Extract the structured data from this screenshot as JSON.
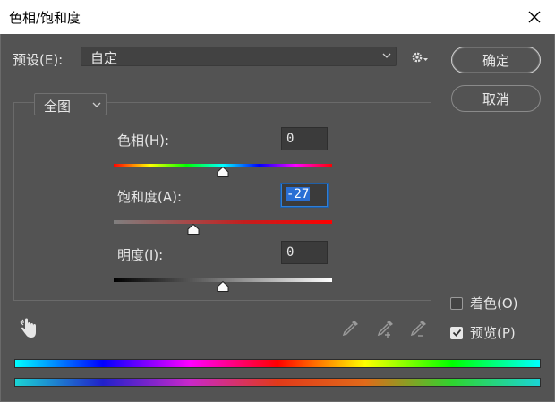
{
  "window": {
    "title": "色相/饱和度"
  },
  "preset": {
    "label": "预设(E):",
    "value": "自定"
  },
  "buttons": {
    "ok": "确定",
    "cancel": "取消"
  },
  "channel": {
    "value": "全图"
  },
  "sliders": [
    {
      "label": "色相(H):",
      "value": "0",
      "min": -180,
      "max": 180
    },
    {
      "label": "饱和度(A):",
      "value": "-27",
      "min": -100,
      "max": 100
    },
    {
      "label": "明度(I):",
      "value": "0",
      "min": -100,
      "max": 100
    }
  ],
  "options": {
    "colorize": "着色(O)",
    "colorize_checked": false,
    "preview": "预览(P)",
    "preview_checked": true
  },
  "colors": {
    "background": "#535353",
    "accent": "#2a6fd4"
  }
}
